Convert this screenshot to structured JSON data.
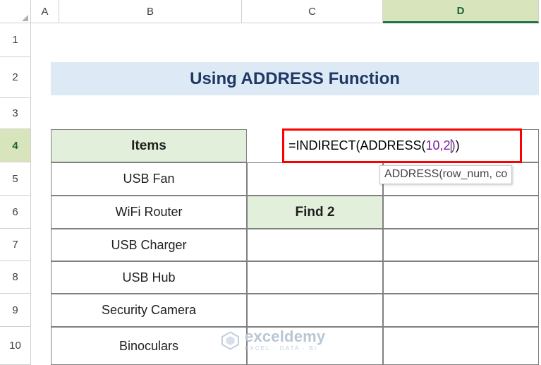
{
  "app": {
    "name": "Microsoft Excel worksheet"
  },
  "columns": [
    {
      "label": "A",
      "selected": false
    },
    {
      "label": "B",
      "selected": false
    },
    {
      "label": "C",
      "selected": false
    },
    {
      "label": "D",
      "selected": true
    }
  ],
  "rows": [
    {
      "label": "1",
      "highlight": false
    },
    {
      "label": "2",
      "highlight": false
    },
    {
      "label": "3",
      "highlight": false
    },
    {
      "label": "4",
      "highlight": true
    },
    {
      "label": "5",
      "highlight": false
    },
    {
      "label": "6",
      "highlight": false
    },
    {
      "label": "7",
      "highlight": false
    },
    {
      "label": "8",
      "highlight": false
    },
    {
      "label": "9",
      "highlight": false
    },
    {
      "label": "10",
      "highlight": false
    }
  ],
  "banner": {
    "title": "Using ADDRESS Function"
  },
  "table": {
    "header_items": "Items",
    "items": [
      "USB Fan",
      "WiFi Router",
      "USB Charger",
      "USB Hub",
      "Security Camera",
      "Binoculars"
    ],
    "find_label": "Find 2"
  },
  "active_cell": {
    "reference": "D4",
    "formula_parts": {
      "start": "=INDIRECT(ADDRESS(",
      "args": "10,2",
      "close_inner": ")",
      "close_outer": ")"
    },
    "full_formula": "=INDIRECT(ADDRESS(10,2))"
  },
  "tooltip": {
    "text": "ADDRESS(row_num, co"
  },
  "watermark": {
    "main": "exceldemy",
    "sub": "EXCEL · DATA · BI"
  },
  "colors": {
    "banner_bg": "#ddeaf6",
    "banner_text": "#1f3864",
    "header_green": "#e2efda",
    "selected_column": "#d8e4bc",
    "excel_green": "#217346",
    "active_border": "#ff0000",
    "grid_border": "#808080"
  }
}
